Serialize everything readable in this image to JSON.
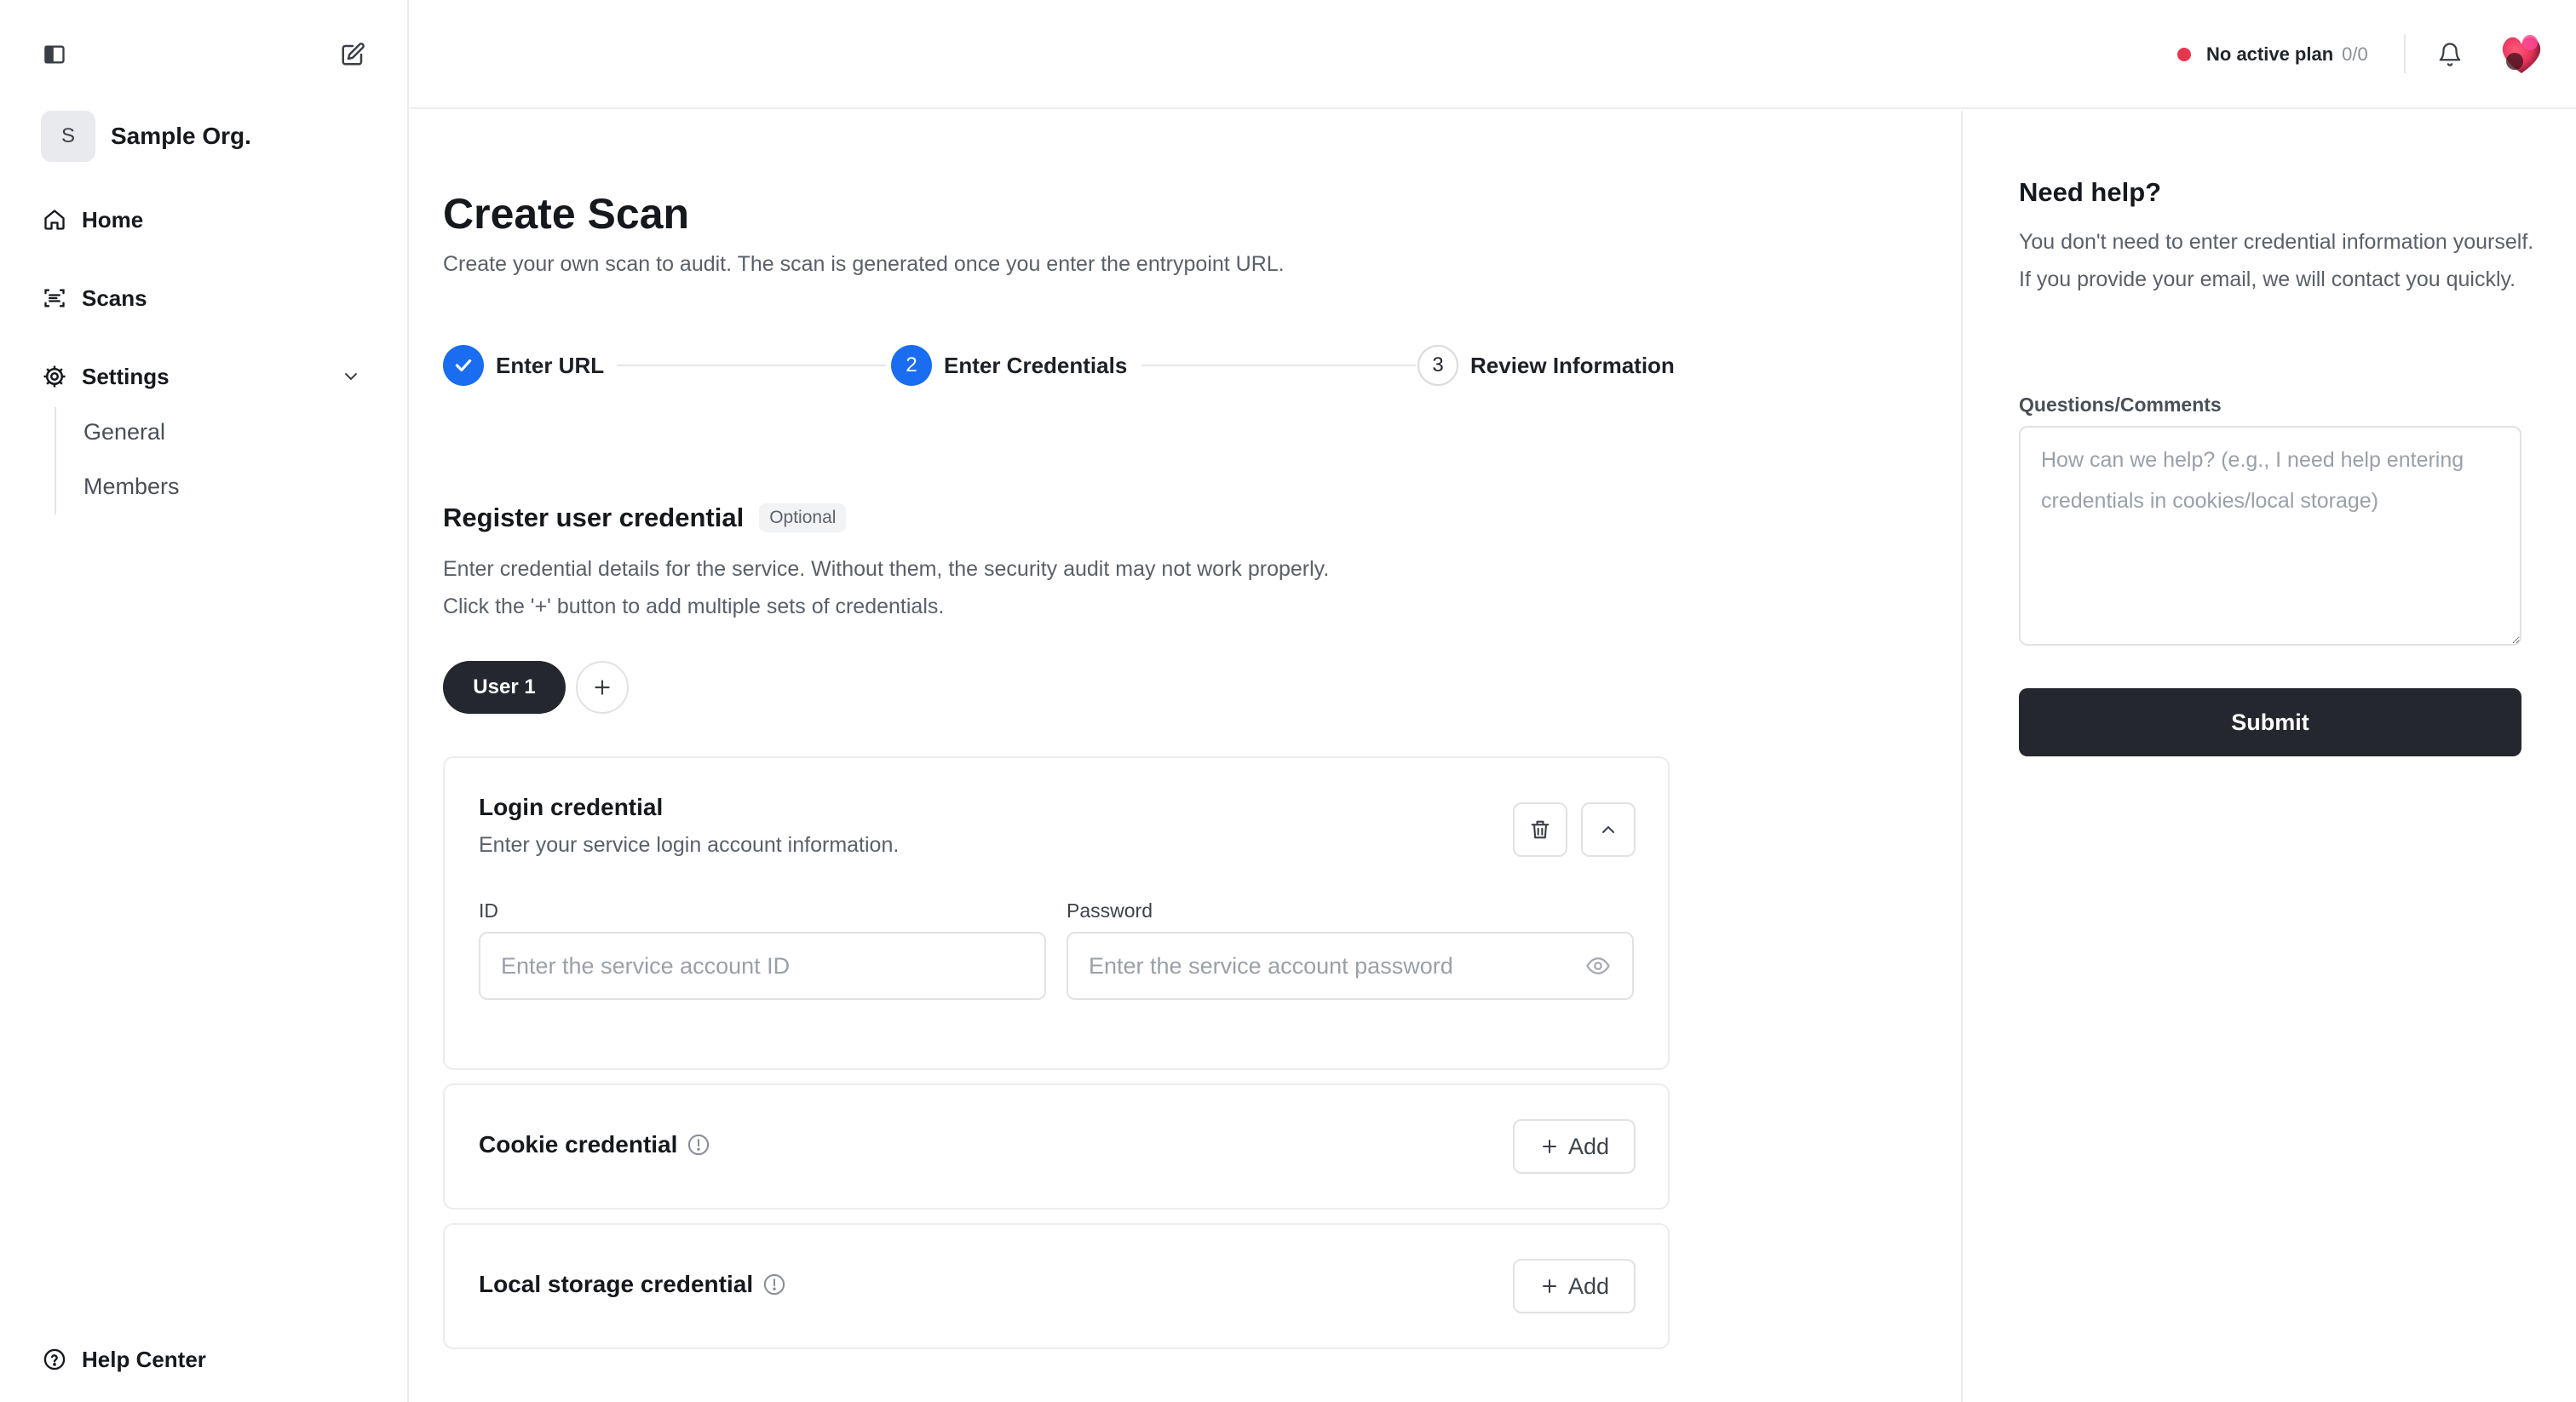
{
  "sidebar": {
    "org": {
      "initial": "S",
      "name": "Sample Org."
    },
    "nav": {
      "home": "Home",
      "scans": "Scans",
      "settings": "Settings"
    },
    "settings_sub": {
      "general": "General",
      "members": "Members"
    },
    "help_center": "Help Center"
  },
  "topbar": {
    "plan_label": "No active plan",
    "plan_count": "0/0",
    "plan_status_color": "#e5384f"
  },
  "main": {
    "title": "Create Scan",
    "subtitle": "Create your own scan to audit. The scan is generated once you enter the entrypoint URL.",
    "steps": [
      {
        "number": "",
        "label": "Enter URL",
        "state": "done"
      },
      {
        "number": "2",
        "label": "Enter Credentials",
        "state": "active"
      },
      {
        "number": "3",
        "label": "Review Information",
        "state": "todo"
      }
    ],
    "section": {
      "title": "Register user credential",
      "badge": "Optional",
      "desc_line1": "Enter credential details for the service. Without them, the security audit may not work properly.",
      "desc_line2": "Click the '+' button to add multiple sets of credentials."
    },
    "user_tab": "User 1",
    "login": {
      "title": "Login credential",
      "desc": "Enter your service login account information.",
      "id_label": "ID",
      "id_placeholder": "Enter the service account ID",
      "password_label": "Password",
      "password_placeholder": "Enter the service account password"
    },
    "cookie": {
      "title": "Cookie credential",
      "add_label": "Add"
    },
    "local_storage": {
      "title": "Local storage credential",
      "add_label": "Add"
    }
  },
  "help": {
    "title": "Need help?",
    "desc": "You don't need to enter credential information yourself. If you provide your email, we will contact you quickly.",
    "questions_label": "Questions/Comments",
    "questions_placeholder": "How can we help? (e.g., I need help entering credentials in cookies/local storage)",
    "submit_label": "Submit"
  },
  "colors": {
    "accent": "#1a6cf0",
    "dark_button": "#24282e"
  }
}
